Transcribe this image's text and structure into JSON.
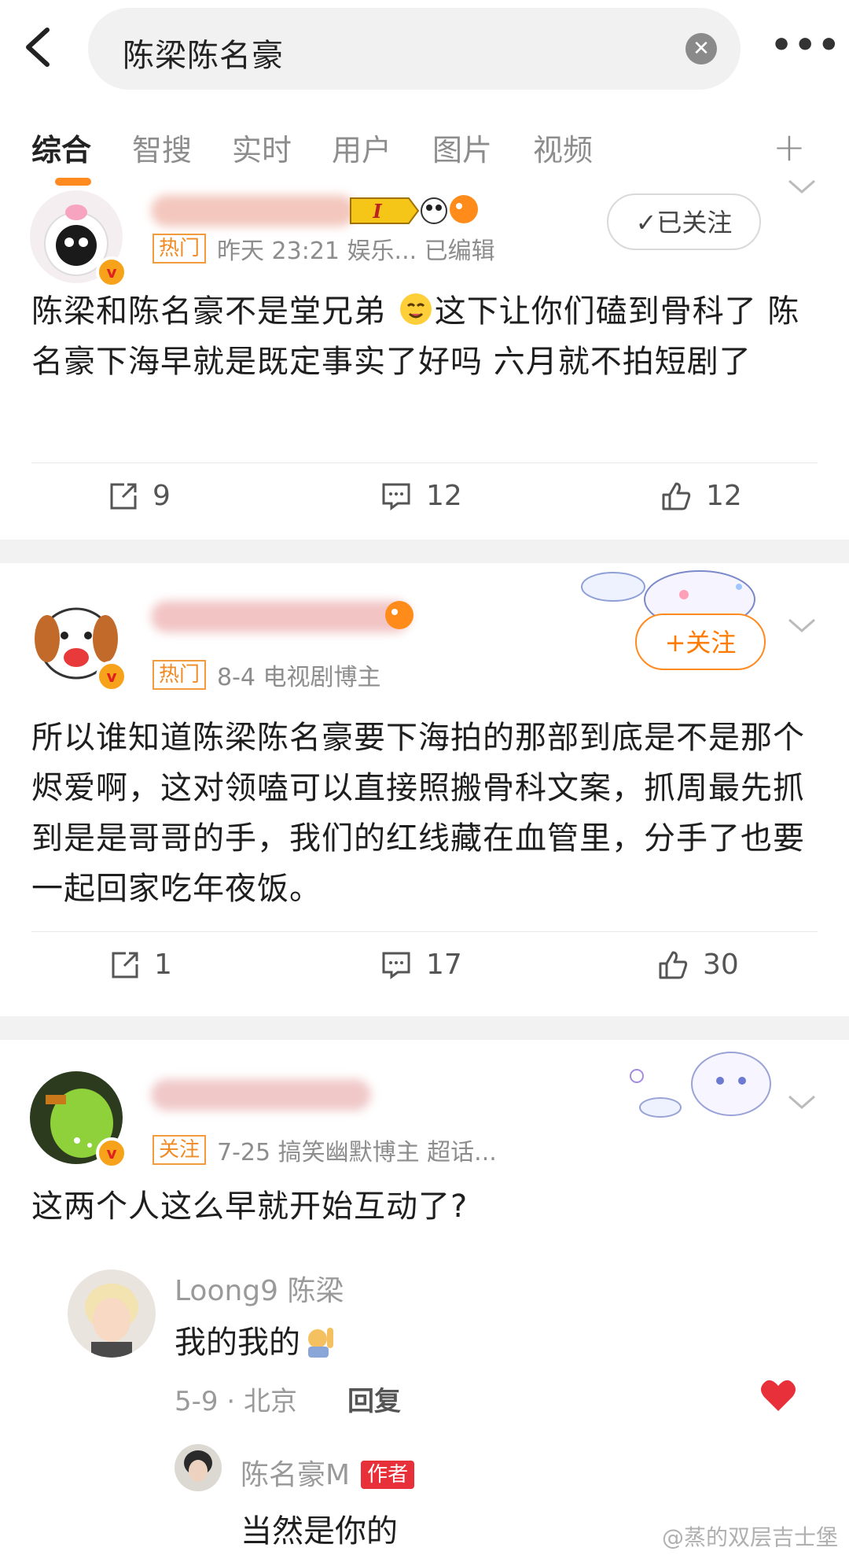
{
  "search": {
    "query": "陈梁陈名豪",
    "clear_label": "✕",
    "more_label": "•••"
  },
  "tabs": [
    {
      "label": "综合"
    },
    {
      "label": "智搜"
    },
    {
      "label": "实时"
    },
    {
      "label": "用户"
    },
    {
      "label": "图片"
    },
    {
      "label": "视频"
    }
  ],
  "tab_plus": "+",
  "posts": [
    {
      "tag": "热门",
      "meta": "昨天 23:21  娱乐...  已编辑",
      "follow_label": "✓已关注",
      "text_1": "陈梁和陈名豪不是堂兄弟 ",
      "text_2": "这下让你们磕到骨科了 陈名豪下海早就是既定事实了好吗 六月就不拍短剧了",
      "reposts": "9",
      "comments": "12",
      "likes": "12"
    },
    {
      "tag": "热门",
      "meta": "8-4  电视剧博主",
      "follow_label": "+关注",
      "text": "所以谁知道陈梁陈名豪要下海拍的那部到底是不是那个烬爱啊，这对领嗑可以直接照搬骨科文案，抓周最先抓到是是哥哥的手，我们的红线藏在血管里，分手了也要一起回家吃年夜饭。",
      "reposts": "1",
      "comments": "17",
      "likes": "30"
    },
    {
      "tag": "关注",
      "meta": "7-25  搞笑幽默博主  超话...",
      "text": "这两个人这么早就开始互动了?",
      "reply": {
        "name": "Loong9 陈梁",
        "text": "我的我的",
        "meta": "5-9 · 北京",
        "reply_label": "回复"
      },
      "sub_reply": {
        "name": "陈名豪M",
        "author_tag": "作者",
        "text": "当然是你的"
      }
    }
  ],
  "watermark": "@蒸的双层吉士堡",
  "colors": {
    "accent": "#ff8a20",
    "tag_orange": "#f08a24",
    "author_red": "#e8303a",
    "like_red": "#e8303a"
  }
}
